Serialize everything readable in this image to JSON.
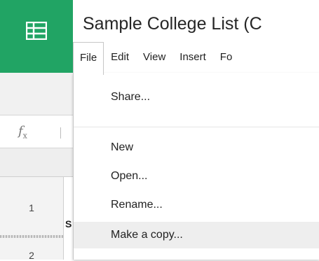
{
  "app": {
    "logo_icon": "sheets-grid-icon",
    "brand_color": "#21a464"
  },
  "document": {
    "title": "Sample College List (C"
  },
  "menubar": {
    "items": [
      {
        "label": "File",
        "active": true
      },
      {
        "label": "Edit"
      },
      {
        "label": "View"
      },
      {
        "label": "Insert"
      },
      {
        "label": "Fo"
      }
    ]
  },
  "formula_bar": {
    "fx_label": "f",
    "fx_sub": "x"
  },
  "grid": {
    "rows": [
      {
        "number": "1"
      },
      {
        "number": "2"
      }
    ],
    "cell_fragment": "S"
  },
  "file_menu": {
    "items": [
      {
        "label": "Share..."
      },
      {
        "label": "New"
      },
      {
        "label": "Open..."
      },
      {
        "label": "Rename..."
      },
      {
        "label": "Make a copy...",
        "highlighted": true
      }
    ]
  }
}
